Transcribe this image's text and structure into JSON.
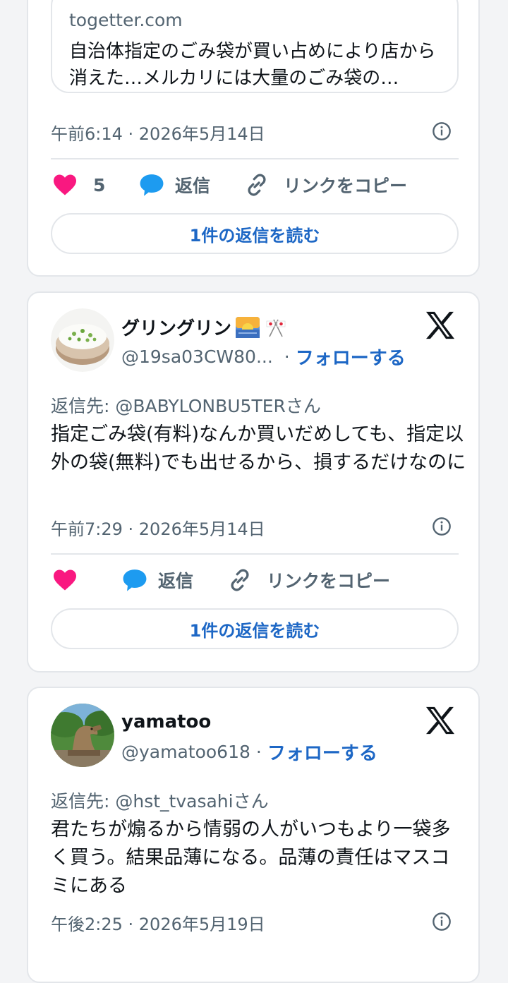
{
  "cards": [
    {
      "link_card": {
        "domain": "togetter.com",
        "title": "自治体指定のごみ袋が買い占めにより店から消えた…メルカリには大量のごみ袋の…"
      },
      "timestamp": "午前6:14 · 2026年5月14日",
      "likes": "5",
      "reply_label": "返信",
      "copy_link_label": "リンクをコピー",
      "read_replies_label": "1件の返信を読む"
    },
    {
      "display_name": "グリングリン",
      "name_emojis": [
        "🌅",
        "🎌"
      ],
      "handle": "@19sa03CW80...",
      "handle_sep": "·",
      "follow_label": "フォローする",
      "reply_to": "返信先: @BABYLONBU5TERさん",
      "text": "指定ごみ袋(有料)なんか買いだめしても、指定以外の袋(無料)でも出せるから、損するだけなのに",
      "timestamp": "午前7:29 · 2026年5月14日",
      "likes": "",
      "reply_label": "返信",
      "copy_link_label": "リンクをコピー",
      "read_replies_label": "1件の返信を読む"
    },
    {
      "display_name": "yamatoo",
      "handle": "@yamatoo618",
      "handle_sep": "·",
      "follow_label": "フォローする",
      "reply_to": "返信先: @hst_tvasahiさん",
      "text": "君たちが煽るから情弱の人がいつもより一袋多く買う。結果品薄になる。品薄の責任はマスコミにある",
      "timestamp": "午後2:25 · 2026年5月19日"
    }
  ],
  "icons": {
    "like": "heart-icon",
    "reply": "speech-bubble-icon",
    "copy_link": "link-icon",
    "info": "info-icon",
    "brand": "x-logo-icon"
  },
  "colors": {
    "like": "#f91880",
    "reply_bubble": "#1d9bf0",
    "accent_link": "#1d67c5",
    "secondary_text": "#536471",
    "border": "#e3e6ea"
  }
}
